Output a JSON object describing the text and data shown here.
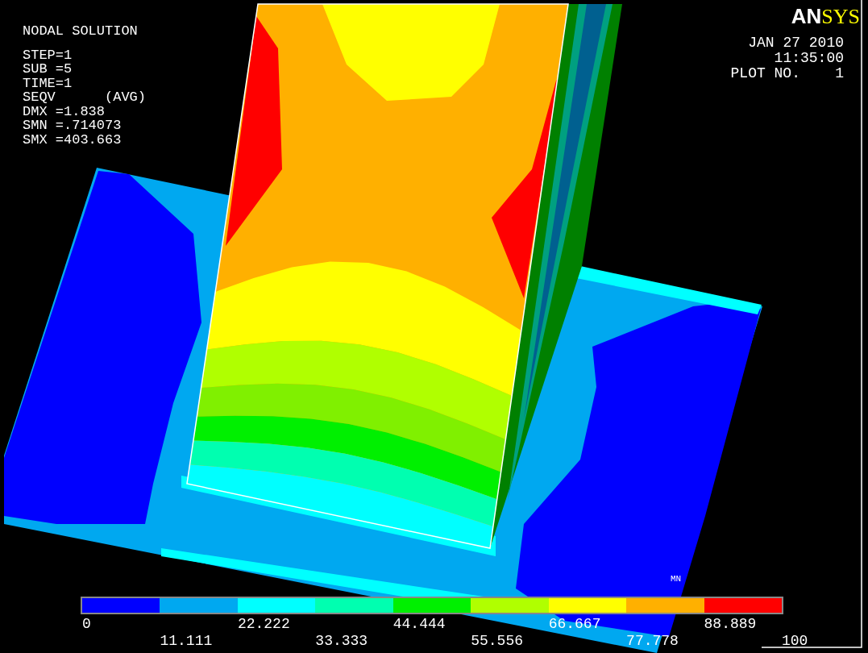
{
  "plot_info": {
    "title": "NODAL SOLUTION",
    "lines": [
      "STEP=1",
      "SUB =5",
      "TIME=1",
      "SEQV      (AVG)",
      "DMX =1.838",
      "SMN =.714073",
      "SMX =403.663"
    ]
  },
  "logo": [
    "AN",
    "SYS"
  ],
  "header": [
    "JAN 27 2010",
    "11:35:00",
    "PLOT NO.    1"
  ],
  "marker": "MN",
  "legend": {
    "swatches": [
      {
        "color": "#0000ff"
      },
      {
        "color": "#00a8f0"
      },
      {
        "color": "#00ffff"
      },
      {
        "color": "#00ffb0"
      },
      {
        "color": "#00f000"
      },
      {
        "color": "#b0ff00"
      },
      {
        "color": "#ffff00"
      },
      {
        "color": "#ffb000"
      },
      {
        "color": "#ff0000"
      }
    ],
    "labels": [
      "0",
      "11.111",
      "22.222",
      "33.333",
      "44.444",
      "55.556",
      "66.667",
      "77.778",
      "88.889",
      "100"
    ]
  }
}
